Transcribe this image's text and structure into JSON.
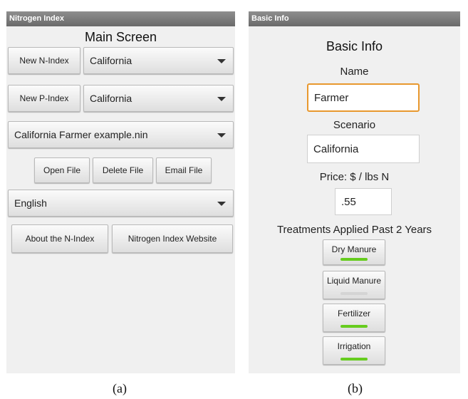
{
  "panel_a": {
    "title": "Nitrogen Index",
    "heading": "Main Screen",
    "new_n_index_label": "New N-Index",
    "n_state_selected": "California",
    "new_p_index_label": "New P-Index",
    "p_state_selected": "California",
    "file_selected": "California Farmer example.nin",
    "open_file_label": "Open File",
    "delete_file_label": "Delete File",
    "email_file_label": "Email File",
    "language_selected": "English",
    "about_label": "About the N-Index",
    "website_label": "Nitrogen Index Website",
    "caption": "(a)"
  },
  "panel_b": {
    "title": "Basic Info",
    "heading": "Basic Info",
    "name_label": "Name",
    "name_value": "Farmer",
    "scenario_label": "Scenario",
    "scenario_value": "California",
    "price_label": "Price: $ / lbs N",
    "price_value": ".55",
    "treatments_label": "Treatments Applied Past 2 Years",
    "treatments": [
      {
        "label": "Dry Manure",
        "on": true
      },
      {
        "label": "Liquid Manure",
        "on": false
      },
      {
        "label": "Fertilizer",
        "on": true
      },
      {
        "label": "Irrigation",
        "on": true
      }
    ],
    "caption": "(b)"
  },
  "colors": {
    "toggle_on": "#66cc1e",
    "toggle_off": "#d4d4d4",
    "focus_border": "#e8982e",
    "titlebar": "#7a7a7a"
  }
}
